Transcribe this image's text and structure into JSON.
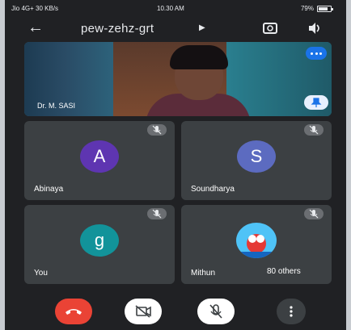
{
  "status_bar": {
    "network": "Jio 4G+ 30 KB/s",
    "time": "10.30 AM",
    "battery": "79%",
    "battery_level": 0.79
  },
  "header": {
    "back_icon": "arrow-left-icon",
    "meeting_code": "pew-zehz-grt",
    "expand_icon": "caret-right-icon",
    "flip_camera_icon": "camera-flip-icon",
    "speaker_icon": "volume-icon"
  },
  "speaker": {
    "name": "Dr. M. SASI",
    "options_icon": "more-horizontal-icon",
    "pin_icon": "pin-icon",
    "accent": "#1a73e8"
  },
  "participants": [
    {
      "name": "Abinaya",
      "initial": "A",
      "color": "#5e35b1",
      "muted": true
    },
    {
      "name": "Soundharya",
      "initial": "S",
      "color": "#5c6bc0",
      "muted": true
    },
    {
      "name": "You",
      "initial": "g",
      "color": "#12939a",
      "muted": true
    },
    {
      "name": "Mithun",
      "initial": "",
      "color": "#4fc3f7",
      "muted": true,
      "others_label": "80 others"
    }
  ],
  "controls": {
    "end_call_icon": "phone-hangup-icon",
    "camera_icon": "camera-off-icon",
    "mic_icon": "mic-off-icon",
    "more_icon": "more-vertical-icon",
    "end_call_color": "#ea4335"
  }
}
